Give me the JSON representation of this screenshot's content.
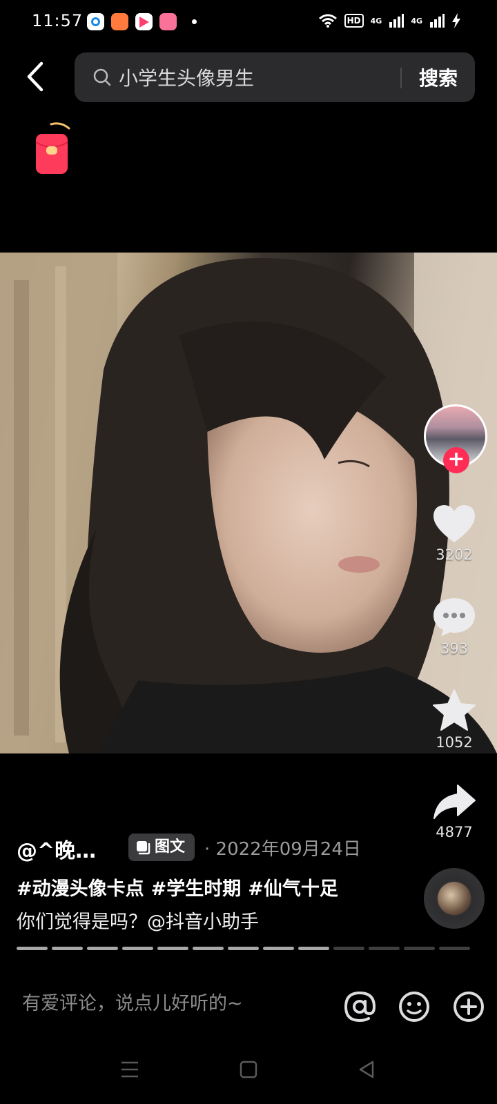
{
  "status_bar": {
    "time": "11:57",
    "app_icons": [
      "browser-icon",
      "app-icon",
      "video-app-icon",
      "bilibili-icon"
    ],
    "hd": "HD",
    "signal_1": "4G",
    "signal_2": "4G"
  },
  "search": {
    "query": "小学生头像男生",
    "button_label": "搜索"
  },
  "post": {
    "author": "@^晚…",
    "type_badge": "图文",
    "date": "· 2022年09月24日",
    "hashtags": [
      "#动漫头像卡点",
      "#学生时期",
      "#仙气十足"
    ],
    "description": "你们觉得是吗？@抖音小助手",
    "slides_total": 13,
    "slides_viewed": 9
  },
  "actions": {
    "likes": "3202",
    "comments": "393",
    "favorites": "1052",
    "shares": "4877"
  },
  "comment_bar": {
    "placeholder": "有爱评论，说点儿好听的~"
  },
  "colors": {
    "accent": "#ff2c55",
    "background": "#000000",
    "search_bg": "#2b2b2e"
  }
}
